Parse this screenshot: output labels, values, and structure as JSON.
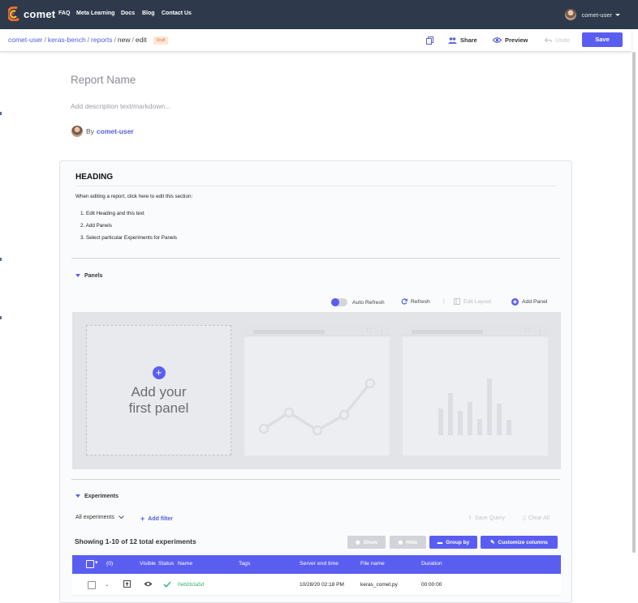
{
  "topnav": {
    "brand": "comet",
    "links": [
      "FAQ",
      "Meta Learning",
      "Docs",
      "Blog",
      "Contact Us"
    ],
    "user": "comet-user"
  },
  "breadcrumb": {
    "workspace": "comet-user",
    "project": "keras-bench",
    "reports": "reports",
    "new": "new",
    "edit": "edit",
    "badge": "Draft"
  },
  "toolbar": {
    "share": "Share",
    "preview": "Preview",
    "undo": "Undo",
    "save": "Save"
  },
  "report": {
    "name_placeholder": "Report Name",
    "description_placeholder": "Add description text/markdown...",
    "by": "By",
    "author": "comet-user"
  },
  "heading_section": {
    "title": "HEADING",
    "intro": "When editing a report, click here to edit this section:",
    "steps": [
      "1. Edit Heading and this text",
      "2. Add Panels",
      "3. Select particular Experiments for Panels"
    ]
  },
  "panels": {
    "label": "Panels",
    "auto_refresh": "Auto Refresh",
    "refresh": "Refresh",
    "edit_layout": "Edit Layout",
    "add_panel": "Add Panel",
    "add_first_line1": "Add your",
    "add_first_line2": "first panel"
  },
  "experiments": {
    "label": "Experiments",
    "filter_select": "All experiments",
    "add_filter": "Add filter",
    "save_query": "Save Query",
    "clear_all": "Clear All",
    "showing": "Showing 1-10 of 12 total experiments",
    "show": "Show",
    "hide": "Hide",
    "group_by": "Group by",
    "customize": "Customize columns",
    "selected_count": "(0)",
    "columns": [
      "Visible",
      "Status",
      "Name",
      "Tags",
      "Server end time",
      "File name",
      "Duration"
    ],
    "rows": [
      {
        "name": "0eb0b3a5d",
        "tags": "",
        "end_time": "10/28/20 02:18 PM",
        "file": "keras_comet.py",
        "duration": "00:00:00"
      }
    ]
  },
  "colors": {
    "nav_bg": "#2e3a4b",
    "accent": "#5a5ef0",
    "link": "#5460d9",
    "success": "#2bb673",
    "draft_bg": "#ffe6d6"
  }
}
